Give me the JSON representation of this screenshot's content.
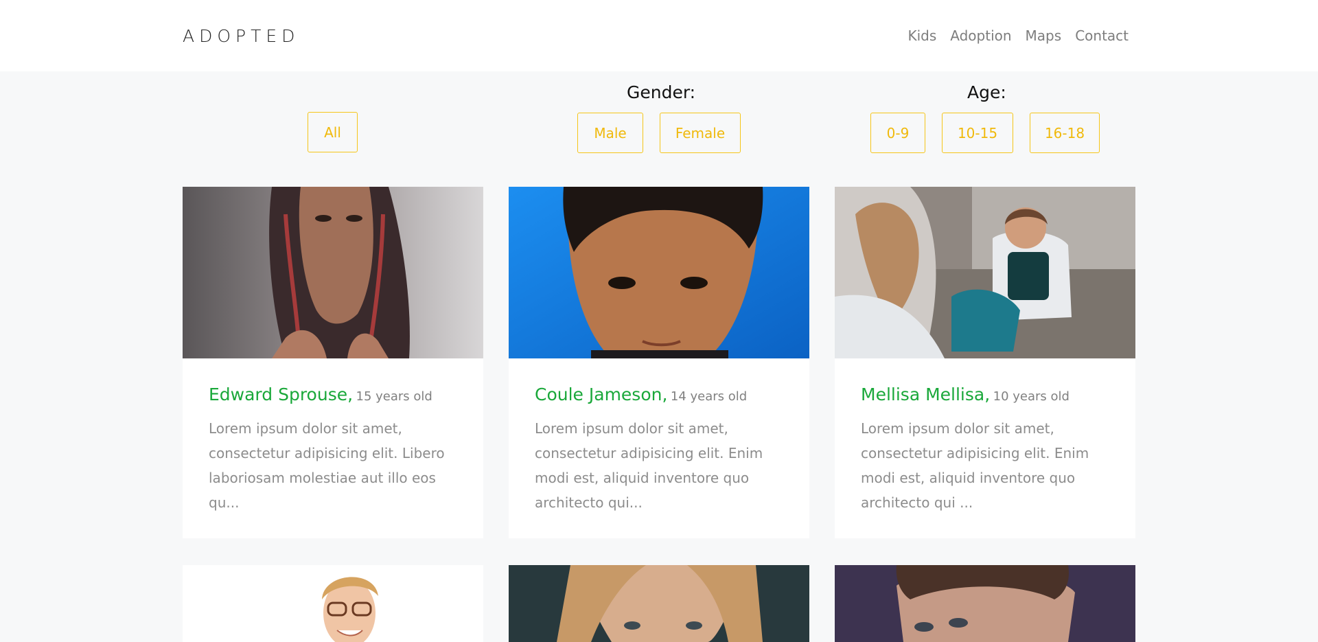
{
  "navbar": {
    "brand": "ADOPTED",
    "links": [
      "Kids",
      "Adoption",
      "Maps",
      "Contact"
    ]
  },
  "filters": {
    "all_label": "All",
    "gender_title": "Gender:",
    "gender_options": [
      "Male",
      "Female"
    ],
    "age_title": "Age:",
    "age_options": [
      "0-9",
      "10-15",
      "16-18"
    ]
  },
  "colors": {
    "accent_yellow": "#f0b90b",
    "name_green": "#1aa83a",
    "background": "#f7f8f9"
  },
  "cards": [
    {
      "name": "Edward Sprouse,",
      "age": "15 years old",
      "text": "Lorem ipsum dolor sit amet, consectetur adipisicing elit. Libero laboriosam molestiae aut illo eos qu..."
    },
    {
      "name": "Coule Jameson,",
      "age": "14 years old",
      "text": "Lorem ipsum dolor sit amet, consectetur adipisicing elit. Enim modi est, aliquid inventore quo architecto qui..."
    },
    {
      "name": "Mellisa Mellisa,",
      "age": "10 years old",
      "text": "Lorem ipsum dolor sit amet, consectetur adipisicing elit. Enim modi est, aliquid inventore quo architecto qui ..."
    },
    {
      "name": "",
      "age": "",
      "text": ""
    },
    {
      "name": "",
      "age": "",
      "text": ""
    },
    {
      "name": "",
      "age": "",
      "text": ""
    }
  ]
}
